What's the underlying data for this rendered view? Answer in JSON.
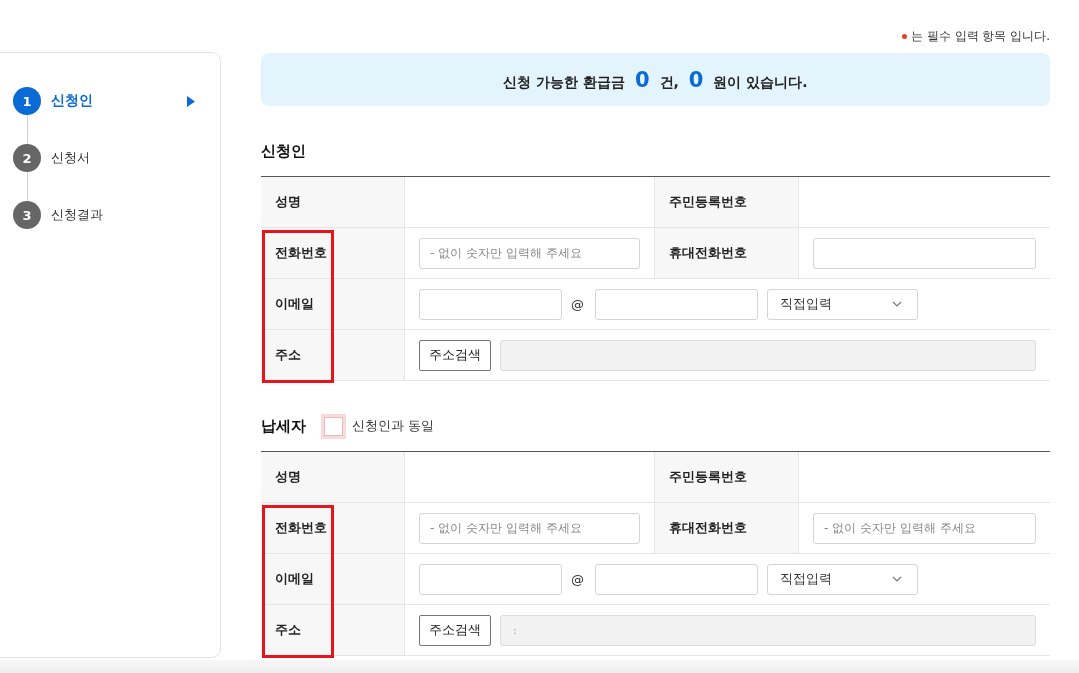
{
  "sidebar": {
    "steps": [
      {
        "number": "1",
        "label": "신청인",
        "selected": true
      },
      {
        "number": "2",
        "label": "신청서",
        "selected": false
      },
      {
        "number": "3",
        "label": "신청결과",
        "selected": false
      }
    ]
  },
  "required_note": "는 필수 입력 항목 입니다.",
  "refund_banner": {
    "prefix": "신청 가능한 환급금",
    "count": "0",
    "count_unit": "건,",
    "amount": "0",
    "suffix": "원이 있습니다."
  },
  "sections": [
    {
      "title": "신청인",
      "rows": [
        {
          "highlighted": false,
          "cells": [
            {
              "kind": "label",
              "text": "성명"
            },
            {
              "kind": "empty"
            },
            {
              "kind": "label",
              "text": "주민등록번호"
            },
            {
              "kind": "empty"
            }
          ]
        },
        {
          "highlighted": true,
          "cells": [
            {
              "kind": "label",
              "text": "전화번호"
            },
            {
              "kind": "input",
              "placeholder": "- 없이 숫자만 입력해 주세요"
            },
            {
              "kind": "label",
              "text": "휴대전화번호"
            },
            {
              "kind": "input"
            }
          ]
        },
        {
          "highlighted": true,
          "cells": [
            {
              "kind": "label",
              "text": "이메일"
            },
            {
              "kind": "email",
              "colspan": 3,
              "separator": "@",
              "domain_select": "직접입력"
            }
          ]
        },
        {
          "highlighted": true,
          "cells": [
            {
              "kind": "label",
              "text": "주소"
            },
            {
              "kind": "address",
              "colspan": 3,
              "button": "주소검색"
            }
          ]
        }
      ]
    },
    {
      "title": "납세자",
      "checkbox": {
        "label": "신청인과 동일",
        "checked": false
      },
      "rows": [
        {
          "highlighted": false,
          "cells": [
            {
              "kind": "label",
              "text": "성명"
            },
            {
              "kind": "empty"
            },
            {
              "kind": "label",
              "text": "주민등록번호"
            },
            {
              "kind": "empty"
            }
          ]
        },
        {
          "highlighted": true,
          "cells": [
            {
              "kind": "label",
              "text": "전화번호"
            },
            {
              "kind": "input",
              "placeholder": "- 없이 숫자만 입력해 주세요"
            },
            {
              "kind": "label",
              "text": "휴대전화번호"
            },
            {
              "kind": "input",
              "placeholder": "- 없이 숫자만 입력해 주세요"
            }
          ]
        },
        {
          "highlighted": true,
          "cells": [
            {
              "kind": "label",
              "text": "이메일"
            },
            {
              "kind": "email",
              "colspan": 3,
              "separator": "@",
              "domain_select": "직접입력"
            }
          ]
        },
        {
          "highlighted": true,
          "cells": [
            {
              "kind": "label",
              "text": "주소"
            },
            {
              "kind": "address",
              "colspan": 3,
              "button": "주소검색",
              "value": ":"
            }
          ]
        }
      ]
    }
  ]
}
